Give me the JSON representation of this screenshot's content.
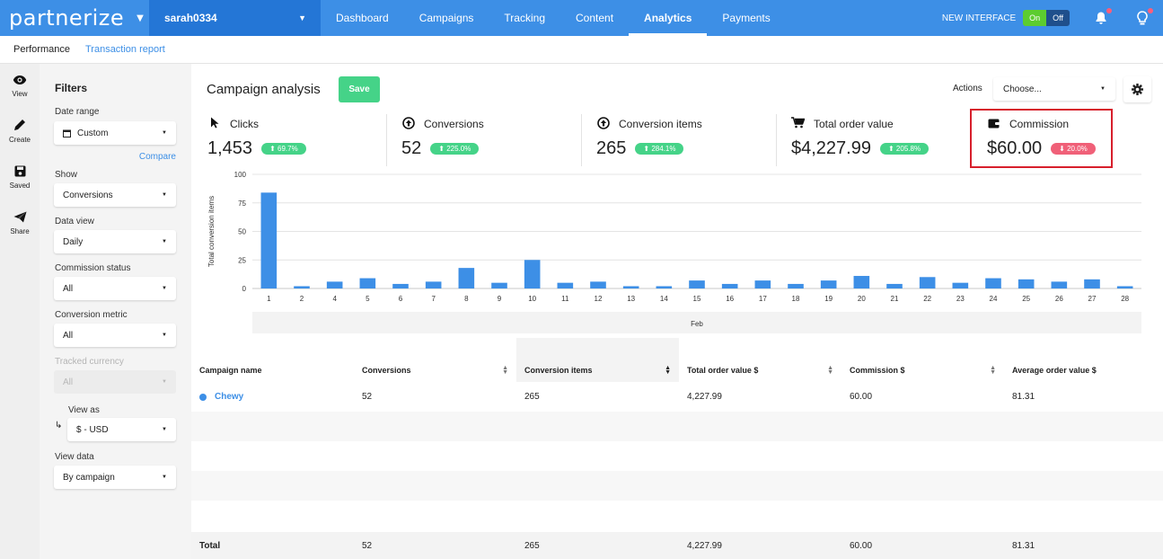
{
  "brand": {
    "logo_text": "partnerize",
    "caret": "▼"
  },
  "account": {
    "name": "sarah0334",
    "caret": "▼"
  },
  "nav": {
    "links": [
      {
        "label": "Dashboard",
        "active": false
      },
      {
        "label": "Campaigns",
        "active": false
      },
      {
        "label": "Tracking",
        "active": false
      },
      {
        "label": "Content",
        "active": false
      },
      {
        "label": "Analytics",
        "active": true
      },
      {
        "label": "Payments",
        "active": false
      }
    ],
    "new_interface_label": "NEW INTERFACE",
    "toggle_on": "On",
    "toggle_off": "Off"
  },
  "subnav": {
    "performance": "Performance",
    "transaction_report": "Transaction report"
  },
  "rail": {
    "view": "View",
    "create": "Create",
    "saved": "Saved",
    "share": "Share"
  },
  "filters": {
    "title": "Filters",
    "date_range_label": "Date range",
    "date_range_value": "Custom",
    "compare": "Compare",
    "show_label": "Show",
    "show_value": "Conversions",
    "data_view_label": "Data view",
    "data_view_value": "Daily",
    "commission_status_label": "Commission status",
    "commission_status_value": "All",
    "conversion_metric_label": "Conversion metric",
    "conversion_metric_value": "All",
    "tracked_currency_label": "Tracked currency",
    "tracked_currency_value": "All",
    "view_as_label": "View as",
    "view_as_value": "$ - USD",
    "view_data_label": "View data",
    "view_data_value": "By campaign"
  },
  "page": {
    "title": "Campaign analysis",
    "save": "Save",
    "actions_label": "Actions",
    "actions_placeholder": "Choose..."
  },
  "metrics": [
    {
      "label": "Clicks",
      "value": "1,453",
      "change": "69.7%",
      "direction": "up",
      "icon": "cursor-icon"
    },
    {
      "label": "Conversions",
      "value": "52",
      "change": "225.0%",
      "direction": "up",
      "icon": "arrow-up-circle-icon"
    },
    {
      "label": "Conversion items",
      "value": "265",
      "change": "284.1%",
      "direction": "up",
      "icon": "arrow-up-circle-icon"
    },
    {
      "label": "Total order value",
      "value": "$4,227.99",
      "change": "205.8%",
      "direction": "up",
      "icon": "cart-icon"
    },
    {
      "label": "Commission",
      "value": "$60.00",
      "change": "20.0%",
      "direction": "down",
      "icon": "wallet-icon"
    }
  ],
  "chart_data": {
    "type": "bar",
    "categories": [
      "1",
      "2",
      "4",
      "5",
      "6",
      "7",
      "8",
      "9",
      "10",
      "11",
      "12",
      "13",
      "14",
      "15",
      "16",
      "17",
      "18",
      "19",
      "20",
      "21",
      "22",
      "23",
      "24",
      "25",
      "26",
      "27",
      "28"
    ],
    "values": [
      84,
      2,
      6,
      9,
      4,
      6,
      18,
      5,
      25,
      5,
      6,
      2,
      2,
      7,
      4,
      7,
      4,
      7,
      11,
      4,
      10,
      5,
      9,
      8,
      6,
      8,
      2
    ],
    "ylabel": "Total conversion items",
    "xlabel": "Feb",
    "ylim": [
      0,
      100
    ],
    "yticks": [
      0,
      25,
      50,
      75,
      100
    ],
    "bar_color": "#3d8fe6"
  },
  "table": {
    "headers": [
      "Campaign name",
      "Conversions",
      "Conversion items",
      "Total order value $",
      "Commission $",
      "Average order value $"
    ],
    "rows": [
      {
        "campaign": "Chewy",
        "conversions": "52",
        "conversion_items": "265",
        "total_order_value": "4,227.99",
        "commission": "60.00",
        "average_order_value": "81.31"
      }
    ],
    "total": {
      "label": "Total",
      "conversions": "52",
      "conversion_items": "265",
      "total_order_value": "4,227.99",
      "commission": "60.00",
      "average_order_value": "81.31"
    }
  }
}
